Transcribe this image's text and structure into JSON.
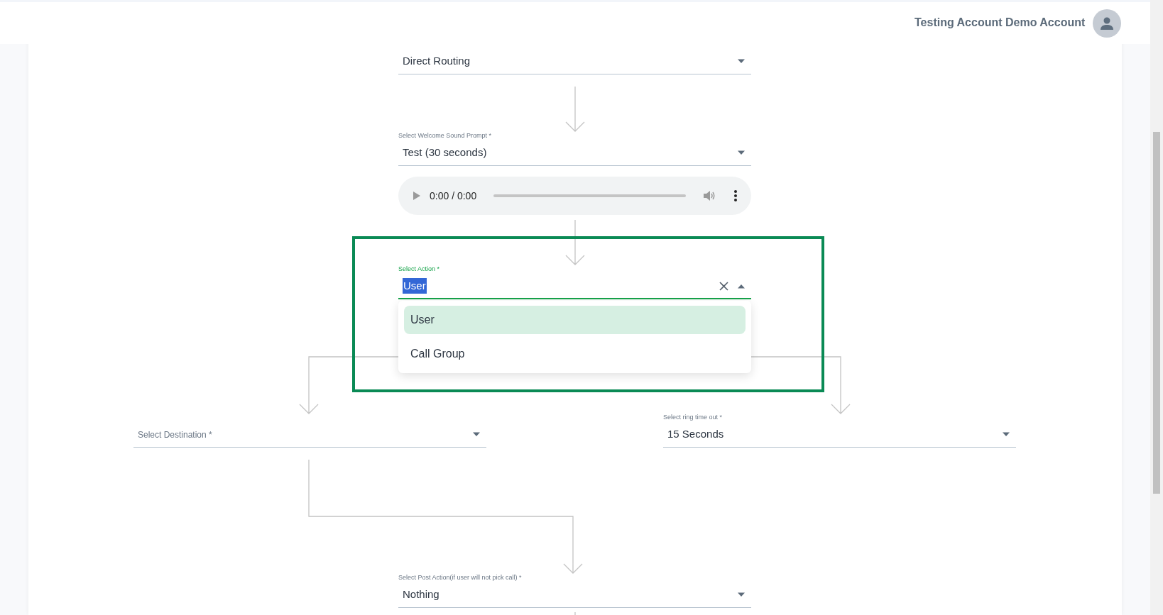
{
  "header": {
    "account_name": "Testing Account Demo Account"
  },
  "routing": {
    "value": "Direct Routing"
  },
  "welcome_prompt": {
    "label": "Select Welcome Sound Prompt *",
    "value": "Test (30 seconds)"
  },
  "audio_player": {
    "time": "0:00 / 0:00"
  },
  "action": {
    "label": "Select Action *",
    "value": "User",
    "focused": true,
    "expanded": true,
    "highlighted": true,
    "options": [
      {
        "label": "User",
        "selected": true
      },
      {
        "label": "Call Group",
        "selected": false
      }
    ]
  },
  "destination": {
    "placeholder": "Select Destination *"
  },
  "ring_timeout": {
    "label": "Select ring time out *",
    "value": "15 Seconds"
  },
  "post_action": {
    "label": "Select Post Action(if user will not pick call) *",
    "value": "Nothing"
  }
}
